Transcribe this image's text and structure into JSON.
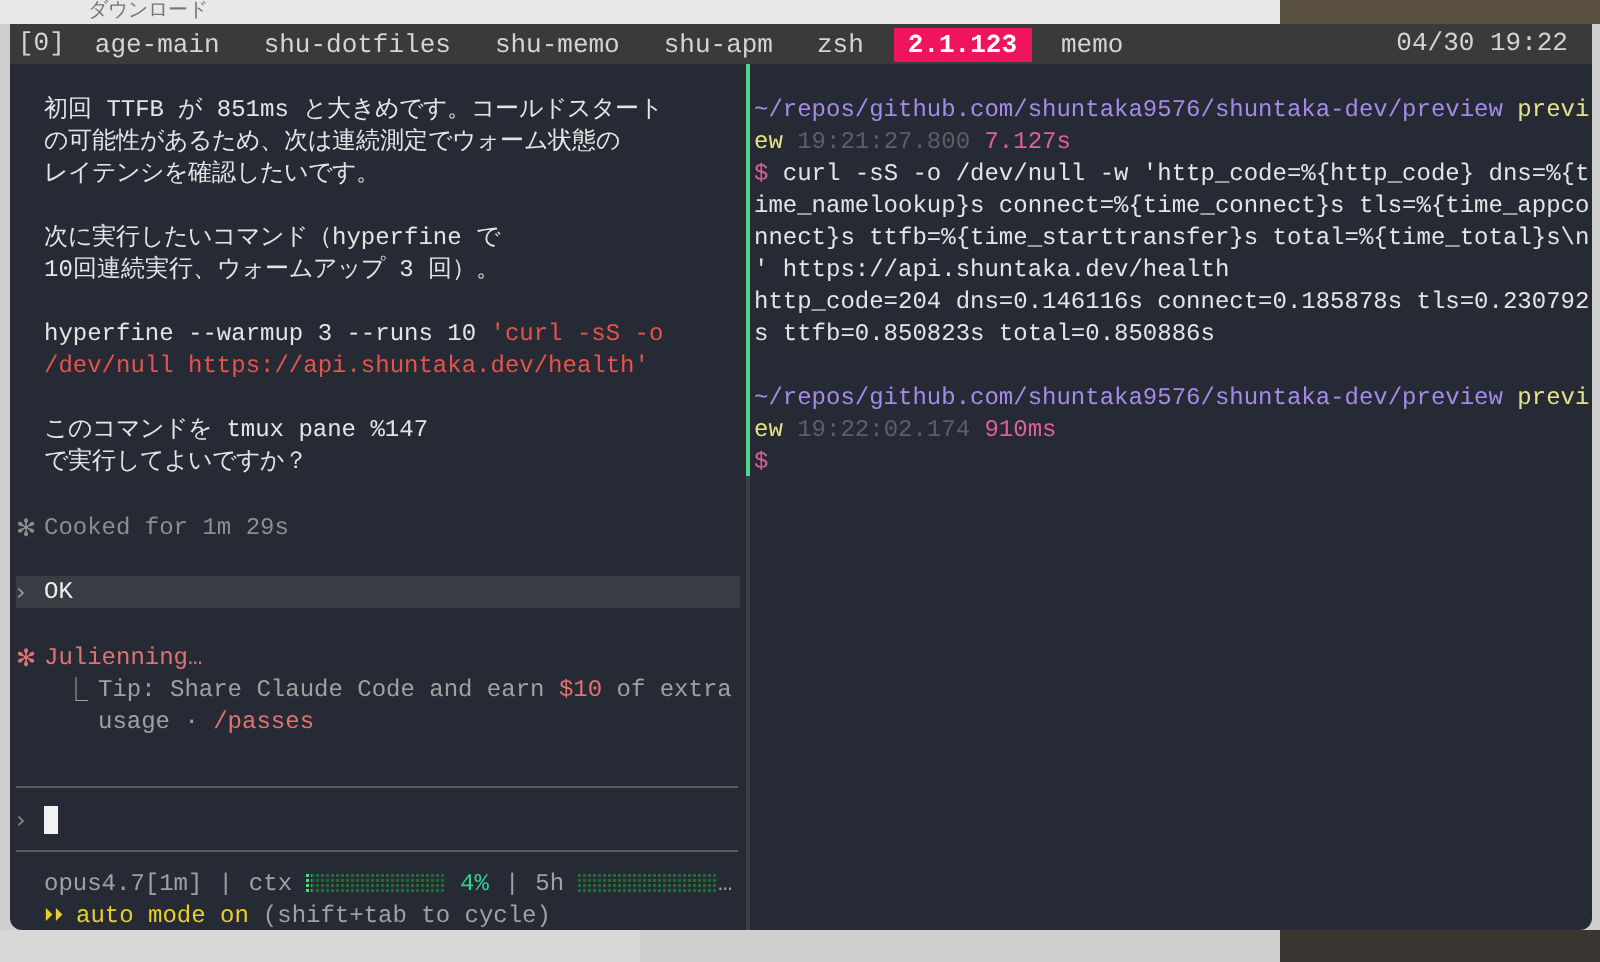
{
  "desktop": {
    "toolbar_label": "ダウンロード"
  },
  "status_bar": {
    "session": "[0]",
    "windows": [
      {
        "name": "age-main",
        "selected": false
      },
      {
        "name": "shu-dotfiles",
        "selected": false
      },
      {
        "name": "shu-memo",
        "selected": false
      },
      {
        "name": "shu-apm",
        "selected": false
      },
      {
        "name": "zsh",
        "selected": false
      },
      {
        "name": "2.1.123",
        "selected": true
      },
      {
        "name": "memo",
        "selected": false
      }
    ],
    "clock": "04/30 19:22"
  },
  "left_pane": {
    "message": [
      {
        "lines": [
          [
            {
              "text": "初回 TTFB が 851ms と大きめです。コールドスタート",
              "kind": "plain"
            }
          ],
          [
            {
              "text": "の可能性があるため、次は連続測定でウォーム状態の",
              "kind": "plain"
            }
          ],
          [
            {
              "text": "レイテンシを確認したいです。",
              "kind": "plain"
            }
          ]
        ]
      },
      {
        "lines": [
          [
            {
              "text": "次に実行したいコマンド（hyperfine で",
              "kind": "plain"
            }
          ],
          [
            {
              "text": "10回連続実行、ウォームアップ 3 回）。",
              "kind": "plain"
            }
          ]
        ]
      },
      {
        "lines": [
          [
            {
              "text": "hyperfine --warmup 3 --runs 10 ",
              "kind": "plain"
            },
            {
              "text": "'curl -sS -o",
              "kind": "code"
            }
          ],
          [
            {
              "text": "/dev/null https://api.shuntaka.dev/health'",
              "kind": "code"
            }
          ]
        ]
      },
      {
        "lines": [
          [
            {
              "text": "このコマンドを tmux pane %147",
              "kind": "plain"
            }
          ],
          [
            {
              "text": "で実行してよいですか？",
              "kind": "plain"
            }
          ]
        ]
      }
    ],
    "cooked": {
      "icon": "✻",
      "text": "Cooked for 1m 29s"
    },
    "user_message": {
      "prompt": "›",
      "text": "OK"
    },
    "activity": {
      "icon": "✻",
      "label": "Julienning…",
      "tip_icon": "⎿",
      "tip": [
        [
          {
            "text": "Tip: Share Claude Code and earn ",
            "kind": "plain"
          },
          {
            "text": "$10",
            "kind": "accent"
          },
          {
            "text": " of extra",
            "kind": "plain"
          }
        ],
        [
          {
            "text": "usage · ",
            "kind": "plain"
          },
          {
            "text": "/passes",
            "kind": "accent"
          }
        ]
      ]
    },
    "input": {
      "prompt": "›"
    },
    "statusline": {
      "model": "opus4.7[1m]",
      "separator": "|",
      "ctx_label": "ctx",
      "ctx_meter": {
        "level": 0.04
      },
      "ctx_percent": "4%",
      "separator_2": "|",
      "window_label": "5h",
      "overflow": "…"
    },
    "mode": {
      "icon": "⏵⏵",
      "label": "auto mode on",
      "hint": "(shift+tab to cycle)"
    }
  },
  "right_pane": {
    "blocks": [
      {
        "lines": [
          [
            {
              "text": "~/repos/github.com/shuntaka9576/shuntaka-dev/preview ",
              "kind": "path"
            },
            {
              "text": "previ",
              "kind": "branch"
            }
          ],
          [
            {
              "text": "ew",
              "kind": "branch"
            },
            {
              "text": " 19:21:27.800 ",
              "kind": "time"
            },
            {
              "text": "7.127s",
              "kind": "duration"
            }
          ],
          [
            {
              "text": "$ ",
              "kind": "prompt"
            },
            {
              "text": "curl -sS -o /dev/null -w 'http_code=%{http_code} dns=%{t",
              "kind": "plain"
            }
          ],
          [
            {
              "text": "ime_namelookup}s connect=%{time_connect}s tls=%{time_appco",
              "kind": "plain"
            }
          ],
          [
            {
              "text": "nnect}s ttfb=%{time_starttransfer}s total=%{time_total}s\\n",
              "kind": "plain"
            }
          ],
          [
            {
              "text": "' https://api.shuntaka.dev/health",
              "kind": "plain"
            }
          ],
          [
            {
              "text": "http_code=204 dns=0.146116s connect=0.185878s tls=0.230792",
              "kind": "plain"
            }
          ],
          [
            {
              "text": "s ttfb=0.850823s total=0.850886s",
              "kind": "plain"
            }
          ]
        ]
      },
      {
        "lines": [
          [
            {
              "text": "~/repos/github.com/shuntaka9576/shuntaka-dev/preview ",
              "kind": "path"
            },
            {
              "text": "previ",
              "kind": "branch"
            }
          ],
          [
            {
              "text": "ew",
              "kind": "branch"
            },
            {
              "text": " 19:22:02.174 ",
              "kind": "time"
            },
            {
              "text": "910ms",
              "kind": "duration"
            }
          ],
          [
            {
              "text": "$",
              "kind": "prompt"
            }
          ]
        ]
      }
    ]
  }
}
